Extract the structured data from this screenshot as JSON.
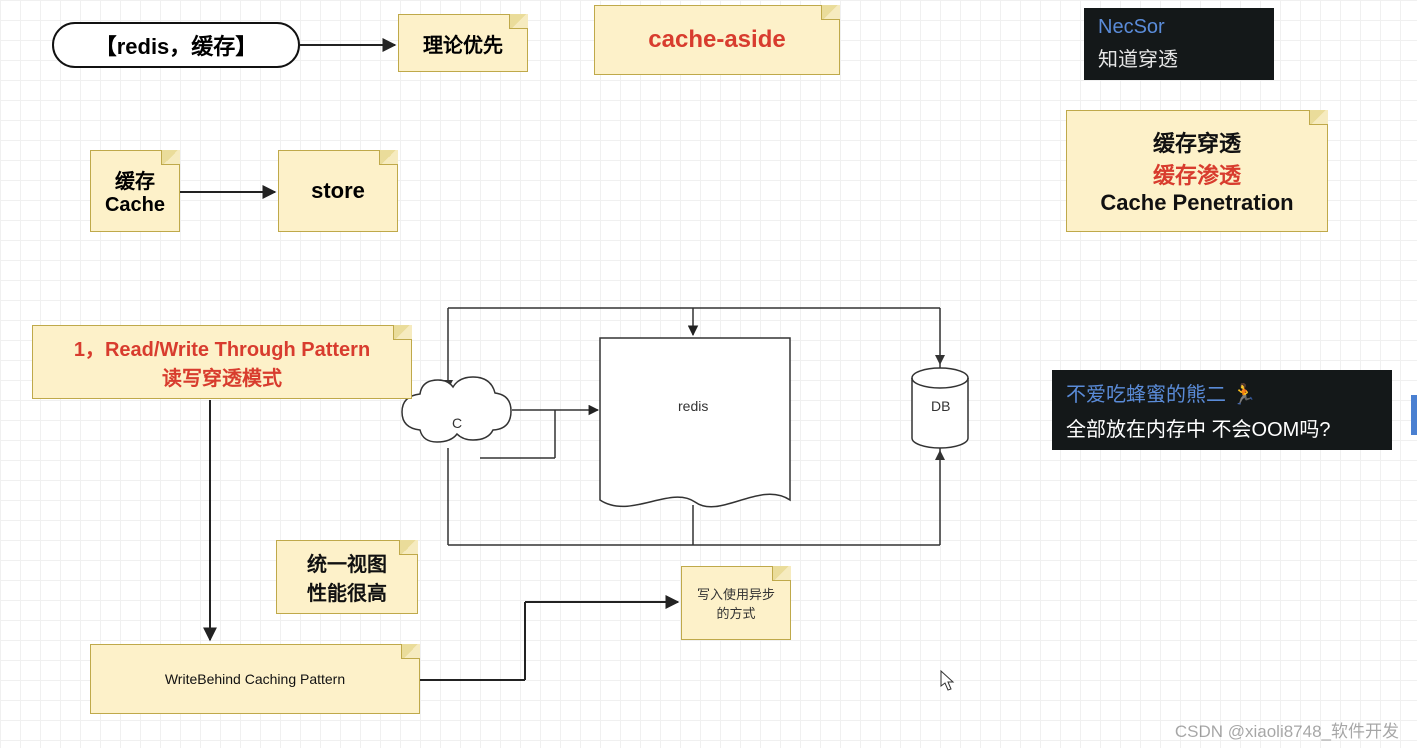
{
  "title_capsule": "【redis，缓存】",
  "notes": {
    "theory": "理论优先",
    "cache_aside": "cache-aside",
    "cache": {
      "line1": "缓存",
      "line2": "Cache"
    },
    "store": "store",
    "rw_through": {
      "line1": "1，Read/Write Through Pattern",
      "line2": "读写穿透模式"
    },
    "unified_view": {
      "line1": "统一视图",
      "line2": "性能很高"
    },
    "write_behind": "WriteBehind Caching Pattern",
    "async_write": {
      "line1": "写入使用异步",
      "line2": "的方式"
    },
    "penetration": {
      "line1": "缓存穿透",
      "line2": "缓存渗透",
      "line3": "Cache Penetration"
    }
  },
  "diagram": {
    "client": "C",
    "redis": "redis",
    "db": "DB"
  },
  "dark_chat1": {
    "name": "NecSor",
    "msg": "知道穿透"
  },
  "dark_chat2": {
    "name": "不爱吃蜂蜜的熊二",
    "emoji": "🏃",
    "msg": "全部放在内存中  不会OOM吗?"
  },
  "watermark": "CSDN @xiaoli8748_软件开发"
}
